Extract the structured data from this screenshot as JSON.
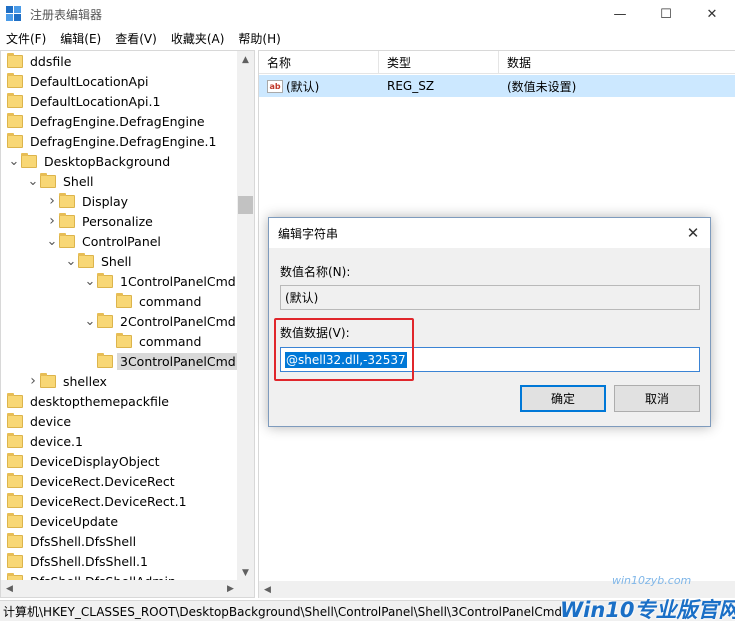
{
  "window": {
    "title": "注册表编辑器",
    "minimize_glyph": "—",
    "maximize_glyph": "☐",
    "close_glyph": "✕"
  },
  "menu": [
    "文件(F)",
    "编辑(E)",
    "查看(V)",
    "收藏夹(A)",
    "帮助(H)"
  ],
  "tree": [
    {
      "label": "ddsfile",
      "level": 0,
      "exp": ""
    },
    {
      "label": "DefaultLocationApi",
      "level": 0,
      "exp": ""
    },
    {
      "label": "DefaultLocationApi.1",
      "level": 0,
      "exp": ""
    },
    {
      "label": "DefragEngine.DefragEngine",
      "level": 0,
      "exp": ""
    },
    {
      "label": "DefragEngine.DefragEngine.1",
      "level": 0,
      "exp": ""
    },
    {
      "label": "DesktopBackground",
      "level": 0,
      "exp": "v"
    },
    {
      "label": "Shell",
      "level": 1,
      "exp": "v"
    },
    {
      "label": "Display",
      "level": 2,
      "exp": ">"
    },
    {
      "label": "Personalize",
      "level": 2,
      "exp": ">"
    },
    {
      "label": "ControlPanel",
      "level": 2,
      "exp": "v"
    },
    {
      "label": "Shell",
      "level": 3,
      "exp": "v"
    },
    {
      "label": "1ControlPanelCmd",
      "level": 4,
      "exp": "v"
    },
    {
      "label": "command",
      "level": 5,
      "exp": ""
    },
    {
      "label": "2ControlPanelCmd",
      "level": 4,
      "exp": "v"
    },
    {
      "label": "command",
      "level": 5,
      "exp": ""
    },
    {
      "label": "3ControlPanelCmd",
      "level": 4,
      "exp": "",
      "selected": true
    },
    {
      "label": "shellex",
      "level": 1,
      "exp": ">"
    },
    {
      "label": "desktopthemepackfile",
      "level": 0,
      "exp": ""
    },
    {
      "label": "device",
      "level": 0,
      "exp": ""
    },
    {
      "label": "device.1",
      "level": 0,
      "exp": ""
    },
    {
      "label": "DeviceDisplayObject",
      "level": 0,
      "exp": ""
    },
    {
      "label": "DeviceRect.DeviceRect",
      "level": 0,
      "exp": ""
    },
    {
      "label": "DeviceRect.DeviceRect.1",
      "level": 0,
      "exp": ""
    },
    {
      "label": "DeviceUpdate",
      "level": 0,
      "exp": ""
    },
    {
      "label": "DfsShell.DfsShell",
      "level": 0,
      "exp": ""
    },
    {
      "label": "DfsShell.DfsShell.1",
      "level": 0,
      "exp": ""
    },
    {
      "label": "DfsShell.DfsShellAdmin",
      "level": 0,
      "exp": ""
    }
  ],
  "list": {
    "headers": [
      "名称",
      "类型",
      "数据"
    ],
    "row": {
      "name": "(默认)",
      "type": "REG_SZ",
      "data": "(数值未设置)",
      "icon_text": "ab"
    }
  },
  "status": "计算机\\HKEY_CLASSES_ROOT\\DesktopBackground\\Shell\\ControlPanel\\Shell\\3ControlPanelCmd",
  "watermark": {
    "url": "win10zyb.com",
    "brand": "Win10专业版官网"
  },
  "dialog": {
    "title": "编辑字符串",
    "close_glyph": "✕",
    "name_label": "数值名称(N):",
    "name_value": "(默认)",
    "data_label": "数值数据(V):",
    "data_value": "@shell32.dll,-32537",
    "ok": "确定",
    "cancel": "取消"
  },
  "colors": {
    "selection": "#0078d7",
    "highlight_box": "#e0262b",
    "list_selected": "#cce8ff"
  }
}
